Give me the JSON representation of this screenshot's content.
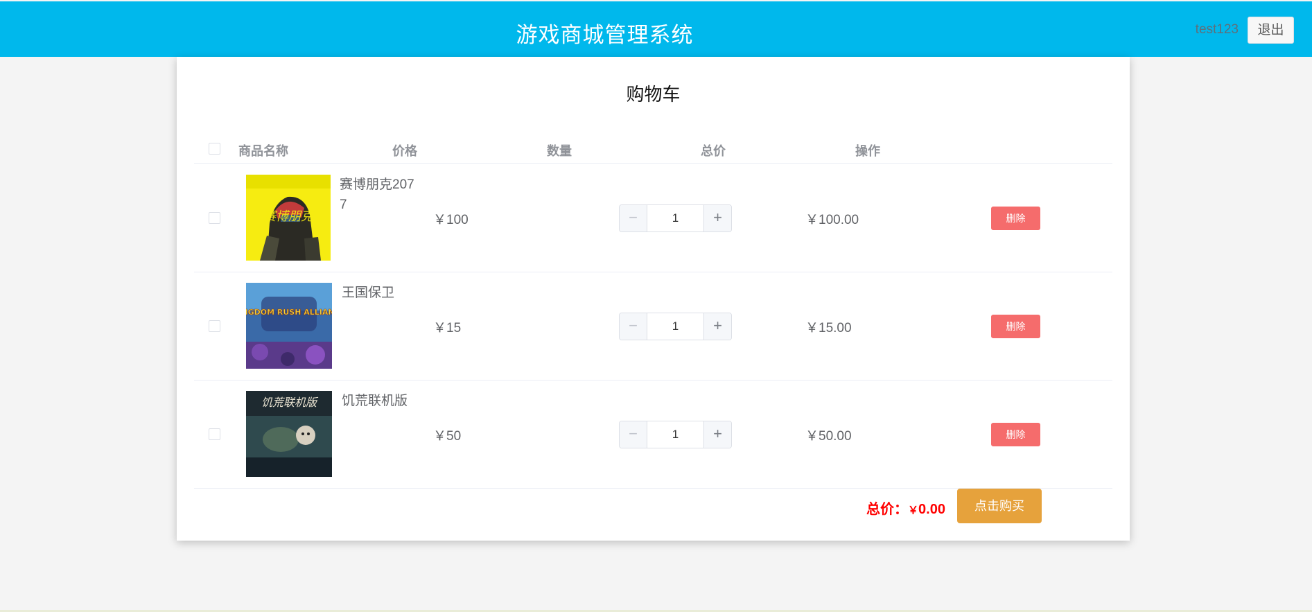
{
  "header": {
    "title": "游戏商城管理系统",
    "username": "test123",
    "logout_label": "退出",
    "color": "#00b8ec"
  },
  "cart": {
    "title": "购物车",
    "columns": {
      "name": "商品名称",
      "price": "价格",
      "quantity": "数量",
      "total": "总价",
      "action": "操作"
    },
    "items": [
      {
        "name": "赛博朋克2077",
        "price": "￥100",
        "quantity": "1",
        "subtotal": "￥100.00",
        "delete_label": "删除",
        "image_caption": "赛博朋克"
      },
      {
        "name": "王国保卫",
        "price": "￥15",
        "quantity": "1",
        "subtotal": "￥15.00",
        "delete_label": "删除",
        "image_caption": "KINGDOM RUSH ALLIANCE"
      },
      {
        "name": "饥荒联机版",
        "price": "￥50",
        "quantity": "1",
        "subtotal": "￥50.00",
        "delete_label": "删除",
        "image_caption": "饥荒联机版"
      }
    ],
    "stepper": {
      "minus": "−",
      "plus": "+"
    },
    "total_label": "总价：",
    "total_currency": "￥",
    "total_value": "0.00",
    "buy_label": "点击购买"
  },
  "colors": {
    "delete": "#f56c6c",
    "buy": "#e6a23c",
    "total": "#ff0000"
  }
}
